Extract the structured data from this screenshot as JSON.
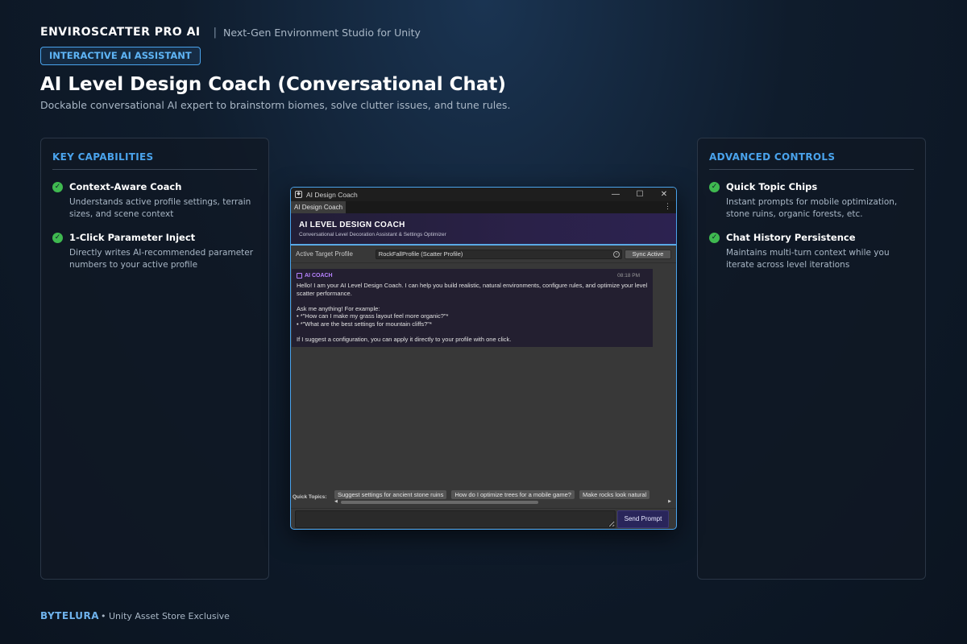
{
  "header": {
    "brand": "ENVIROSCATTER PRO AI",
    "separator": "|",
    "tagline": "Next-Gen Environment Studio for Unity",
    "pill": "INTERACTIVE AI ASSISTANT",
    "title": "AI Level Design Coach (Conversational Chat)",
    "subtitle": "Dockable conversational AI expert to brainstorm biomes, solve clutter issues, and tune rules."
  },
  "left_panel": {
    "heading": "KEY CAPABILITIES",
    "features": [
      {
        "title": "Context-Aware Coach",
        "desc": "Understands active profile settings, terrain sizes, and scene context"
      },
      {
        "title": "1-Click Parameter Inject",
        "desc": "Directly writes AI-recommended parameter numbers to your active profile"
      }
    ]
  },
  "right_panel": {
    "heading": "ADVANCED CONTROLS",
    "features": [
      {
        "title": "Quick Topic Chips",
        "desc": "Instant prompts for mobile optimization, stone ruins, organic forests, etc."
      },
      {
        "title": "Chat History Persistence",
        "desc": "Maintains multi-turn context while you iterate across level iterations"
      }
    ]
  },
  "window": {
    "title": "AI Design Coach",
    "controls": {
      "minimize": "—",
      "maximize": "☐",
      "close": "✕"
    },
    "tab": "AI Design Coach",
    "tab_menu": "⋮",
    "coach_title": "AI LEVEL DESIGN COACH",
    "coach_subtitle": "Conversational Level Decoration Assistant & Settings Optimizer",
    "profile_label": "Active Target Profile",
    "profile_value": "RockFallProfile (Scatter Profile)",
    "sync_button": "Sync Active",
    "message": {
      "sender": "AI COACH",
      "time": "08:18 PM",
      "text": "Hello! I am your AI Level Design Coach. I can help you build realistic, natural environments, configure rules, and optimize your level scatter performance.\n\nAsk me anything! For example:\n• *\"How can I make my grass layout feel more organic?\"*\n• *\"What are the best settings for mountain cliffs?\"*\n\nIf I suggest a configuration, you can apply it directly to your profile with one click."
    },
    "quick_topics_label": "Quick Topics:",
    "chips": [
      "Suggest settings for ancient stone ruins",
      "How do I optimize trees for a mobile game?",
      "Make rocks look natural"
    ],
    "prompt_value": "",
    "send_button": "Send Prompt"
  },
  "footer": {
    "brand": "BYTELURA",
    "note": "• Unity Asset Store Exclusive"
  },
  "colors": {
    "accent": "#4aa3ec",
    "check": "#3fb950",
    "coach": "#b783ff"
  }
}
